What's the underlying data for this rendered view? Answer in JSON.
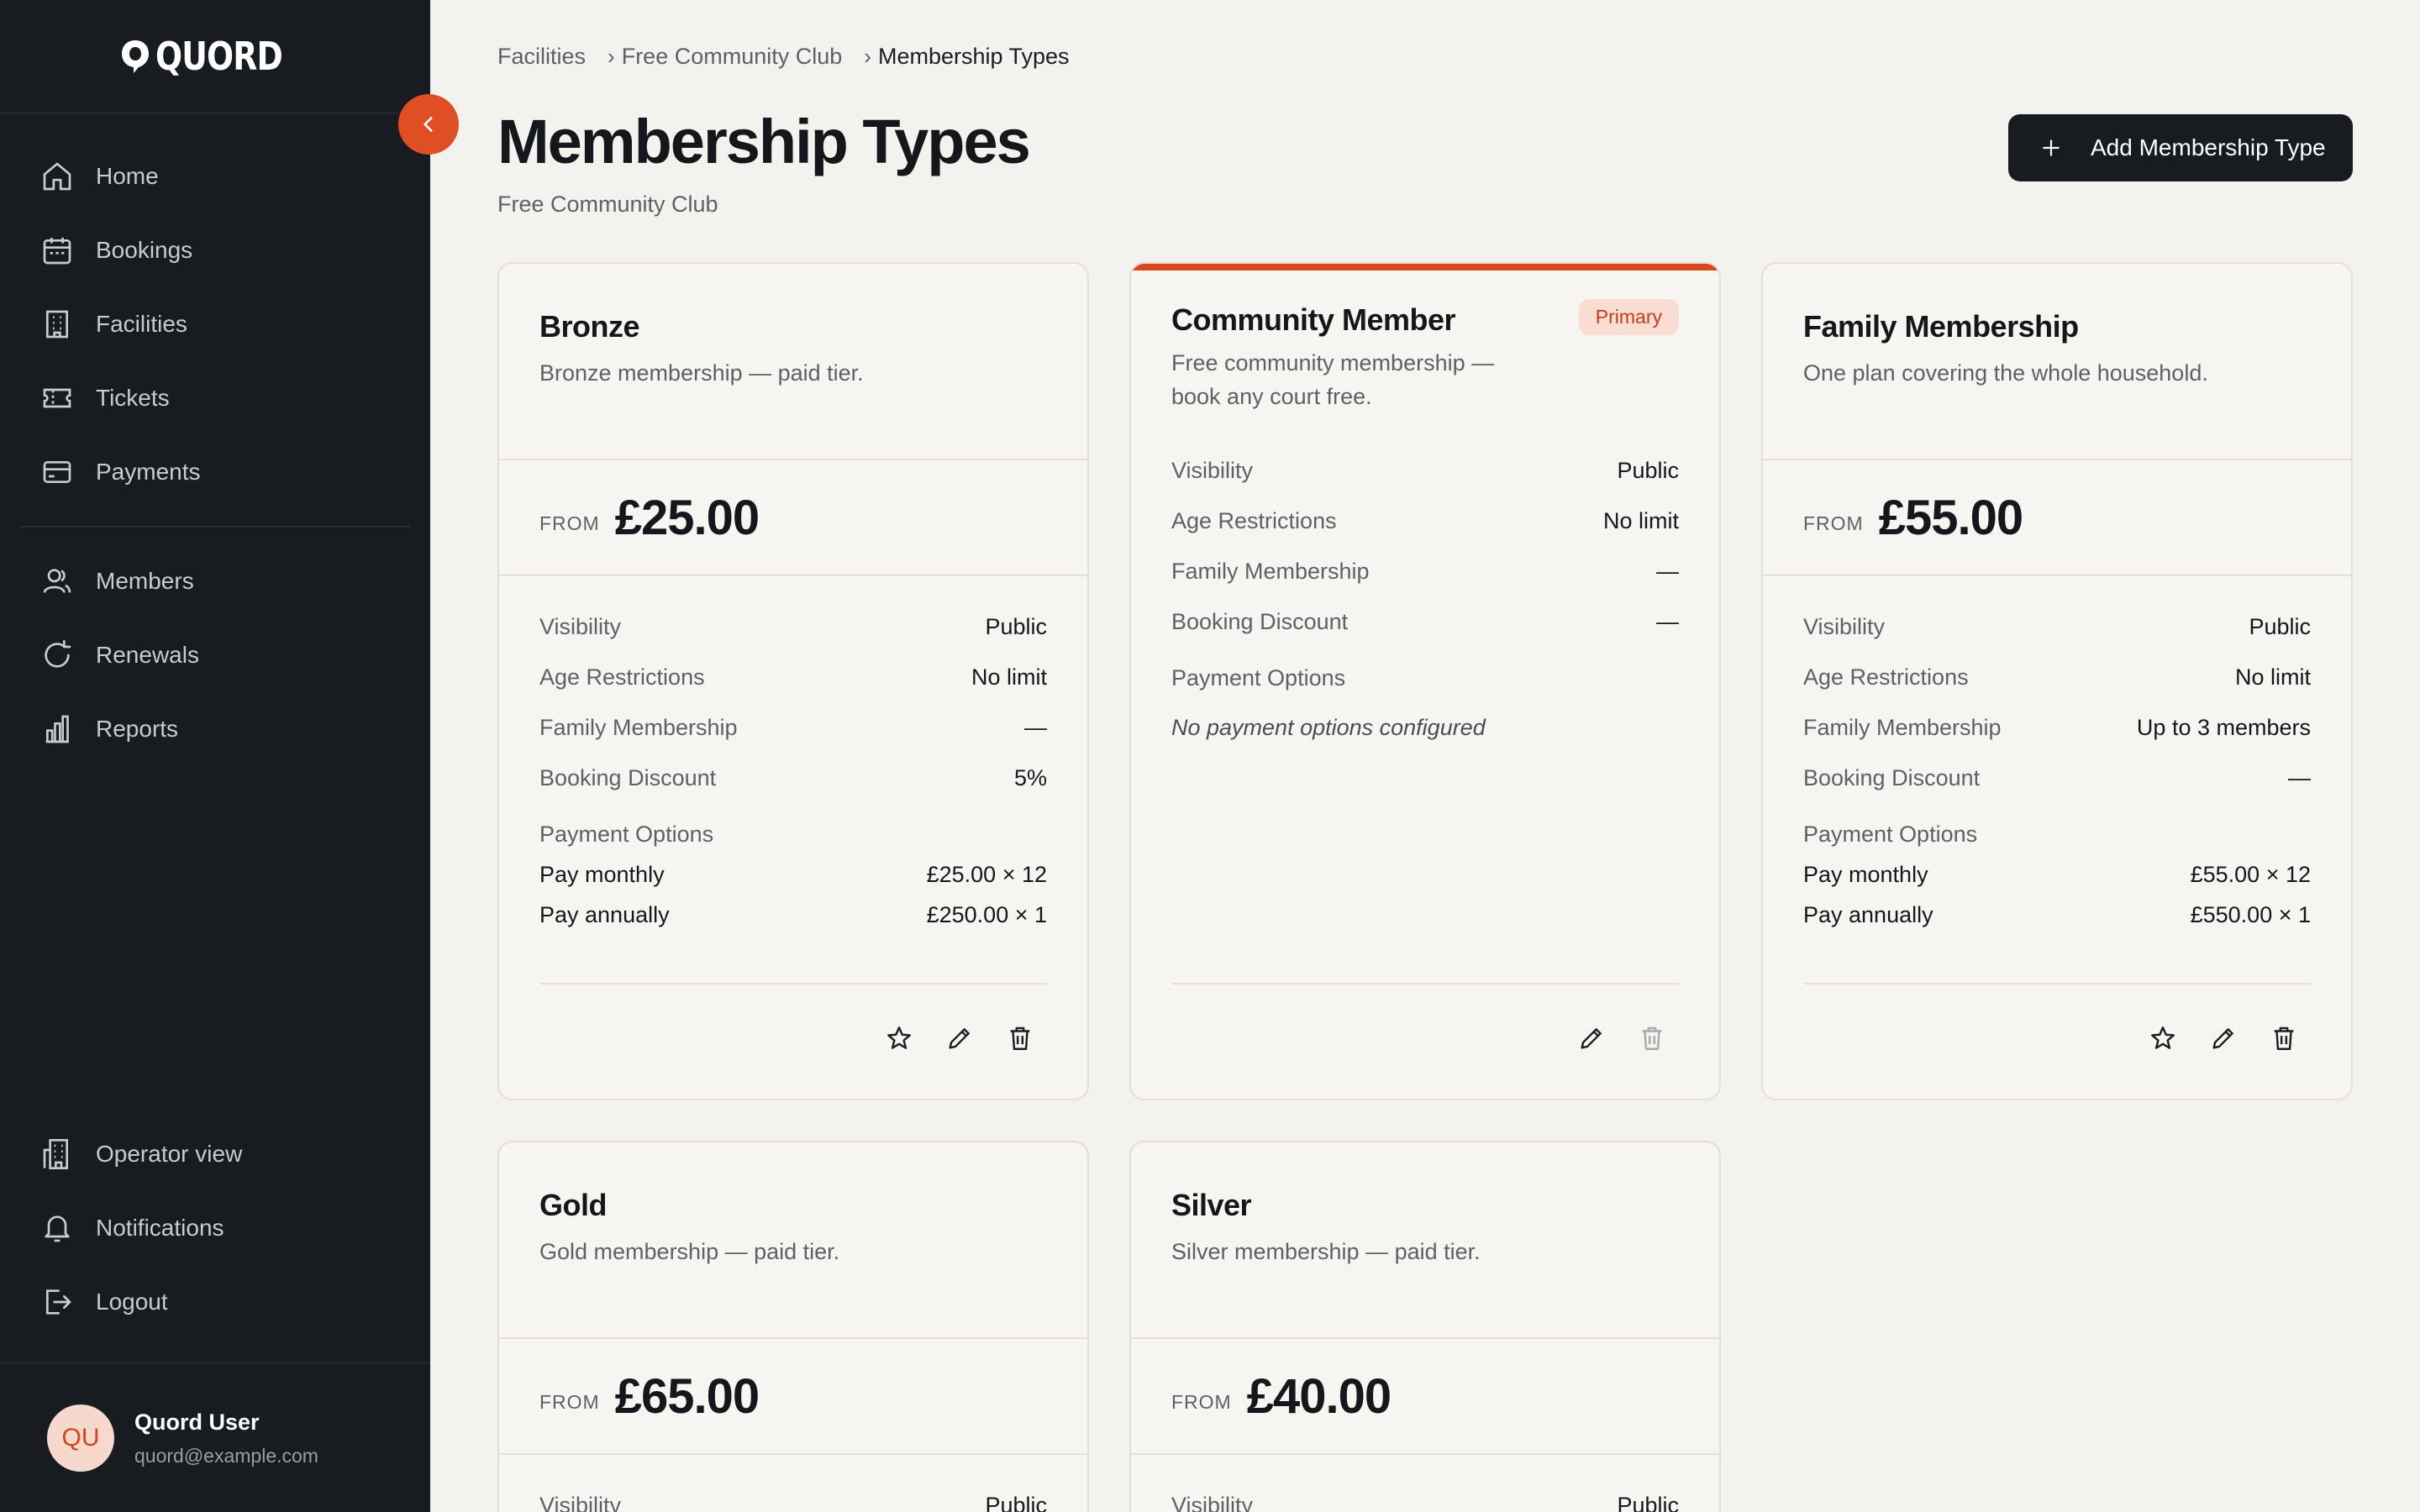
{
  "app": {
    "brand": "QUORD"
  },
  "sidebar": {
    "nav_main": [
      {
        "label": "Home",
        "icon": "home-icon"
      },
      {
        "label": "Bookings",
        "icon": "calendar-icon"
      },
      {
        "label": "Facilities",
        "icon": "building-icon"
      },
      {
        "label": "Tickets",
        "icon": "ticket-icon"
      },
      {
        "label": "Payments",
        "icon": "credit-card-icon"
      }
    ],
    "nav_secondary": [
      {
        "label": "Members",
        "icon": "users-icon"
      },
      {
        "label": "Renewals",
        "icon": "refresh-icon"
      },
      {
        "label": "Reports",
        "icon": "bar-chart-icon"
      }
    ],
    "nav_bottom": [
      {
        "label": "Operator view",
        "icon": "office-building-icon"
      },
      {
        "label": "Notifications",
        "icon": "bell-icon"
      },
      {
        "label": "Logout",
        "icon": "logout-icon"
      }
    ],
    "user": {
      "initials": "QU",
      "name": "Quord User",
      "email": "quord@example.com"
    }
  },
  "breadcrumb": [
    "Facilities",
    "Free Community Club",
    "Membership Types"
  ],
  "header": {
    "title": "Membership Types",
    "subtitle": "Free Community Club",
    "add_button": "Add Membership Type"
  },
  "labels": {
    "from": "FROM",
    "visibility": "Visibility",
    "age": "Age Restrictions",
    "family": "Family Membership",
    "discount": "Booking Discount",
    "payment_options": "Payment Options",
    "no_payment": "No payment options configured",
    "primary_badge": "Primary"
  },
  "cards": [
    {
      "name": "Bronze",
      "description": "Bronze membership — paid tier.",
      "price": "£25.00",
      "visibility": "Public",
      "age": "No limit",
      "family": "—",
      "discount": "5%",
      "payments": [
        {
          "label": "Pay monthly",
          "value": "£25.00 × 12"
        },
        {
          "label": "Pay annually",
          "value": "£250.00 × 1"
        }
      ]
    },
    {
      "name": "Community Member",
      "description": "Free community membership — book any court free.",
      "visibility": "Public",
      "age": "No limit",
      "family": "—",
      "discount": "—"
    },
    {
      "name": "Family Membership",
      "description": "One plan covering the whole household.",
      "price": "£55.00",
      "visibility": "Public",
      "age": "No limit",
      "family": "Up to 3 members",
      "discount": "—",
      "payments": [
        {
          "label": "Pay monthly",
          "value": "£55.00 × 12"
        },
        {
          "label": "Pay annually",
          "value": "£550.00 × 1"
        }
      ]
    },
    {
      "name": "Gold",
      "description": "Gold membership — paid tier.",
      "price": "£65.00",
      "visibility": "Public"
    },
    {
      "name": "Silver",
      "description": "Silver membership — paid tier.",
      "price": "£40.00",
      "visibility": "Public"
    }
  ],
  "colors": {
    "accent": "#e04e24",
    "sidebar": "#181b20",
    "background": "#f4f2ee"
  }
}
